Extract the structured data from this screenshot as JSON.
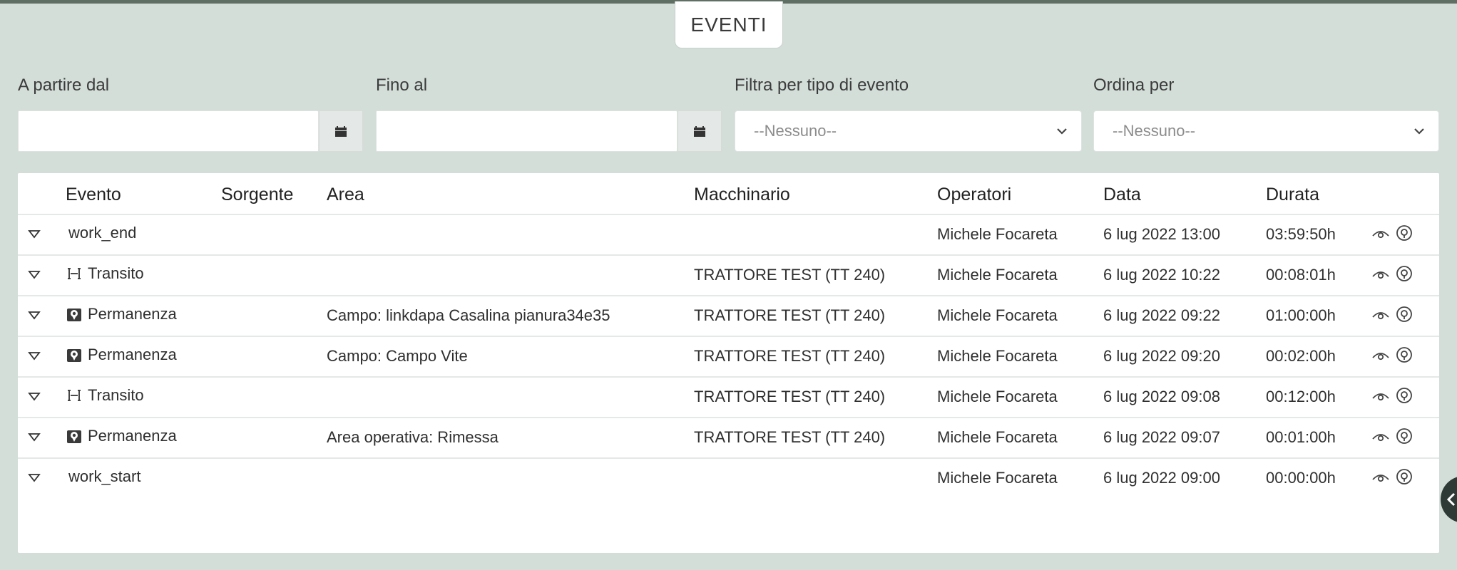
{
  "page": {
    "title": "EVENTI"
  },
  "filters": {
    "from": {
      "label": "A partire dal",
      "value": ""
    },
    "to": {
      "label": "Fino al",
      "value": ""
    },
    "event_type": {
      "label": "Filtra per tipo di evento",
      "selected": "--Nessuno--"
    },
    "order_by": {
      "label": "Ordina per",
      "selected": "--Nessuno--"
    }
  },
  "table": {
    "columns": {
      "evento": "Evento",
      "sorgente": "Sorgente",
      "area": "Area",
      "macchinario": "Macchinario",
      "operatori": "Operatori",
      "data": "Data",
      "durata": "Durata"
    },
    "rows": [
      {
        "icon": "none",
        "evento": "work_end",
        "sorgente": "",
        "area": "",
        "macchinario": "",
        "operatori": "Michele Focareta",
        "data": "6 lug 2022 13:00",
        "durata": "03:59:50h"
      },
      {
        "icon": "transit-icon",
        "evento": "Transito",
        "sorgente": "",
        "area": "",
        "macchinario": "TRATTORE TEST (TT 240)",
        "operatori": "Michele Focareta",
        "data": "6 lug 2022 10:22",
        "durata": "00:08:01h"
      },
      {
        "icon": "location-pin-icon",
        "evento": "Permanenza",
        "sorgente": "",
        "area": "Campo: linkdapa Casalina pianura34e35",
        "macchinario": "TRATTORE TEST (TT 240)",
        "operatori": "Michele Focareta",
        "data": "6 lug 2022 09:22",
        "durata": "01:00:00h"
      },
      {
        "icon": "location-pin-icon",
        "evento": "Permanenza",
        "sorgente": "",
        "area": "Campo: Campo Vite",
        "macchinario": "TRATTORE TEST (TT 240)",
        "operatori": "Michele Focareta",
        "data": "6 lug 2022 09:20",
        "durata": "00:02:00h"
      },
      {
        "icon": "transit-icon",
        "evento": "Transito",
        "sorgente": "",
        "area": "",
        "macchinario": "TRATTORE TEST (TT 240)",
        "operatori": "Michele Focareta",
        "data": "6 lug 2022 09:08",
        "durata": "00:12:00h"
      },
      {
        "icon": "location-pin-icon",
        "evento": "Permanenza",
        "sorgente": "",
        "area": "Area operativa: Rimessa",
        "macchinario": "TRATTORE TEST (TT 240)",
        "operatori": "Michele Focareta",
        "data": "6 lug 2022 09:07",
        "durata": "00:01:00h"
      },
      {
        "icon": "none",
        "evento": "work_start",
        "sorgente": "",
        "area": "",
        "macchinario": "",
        "operatori": "Michele Focareta",
        "data": "6 lug 2022 09:00",
        "durata": "00:00:00h"
      }
    ]
  },
  "colors": {
    "background": "#d3ded9",
    "header_bar": "#5f6f63",
    "panel": "#ffffff",
    "handle": "#2e3a36"
  }
}
